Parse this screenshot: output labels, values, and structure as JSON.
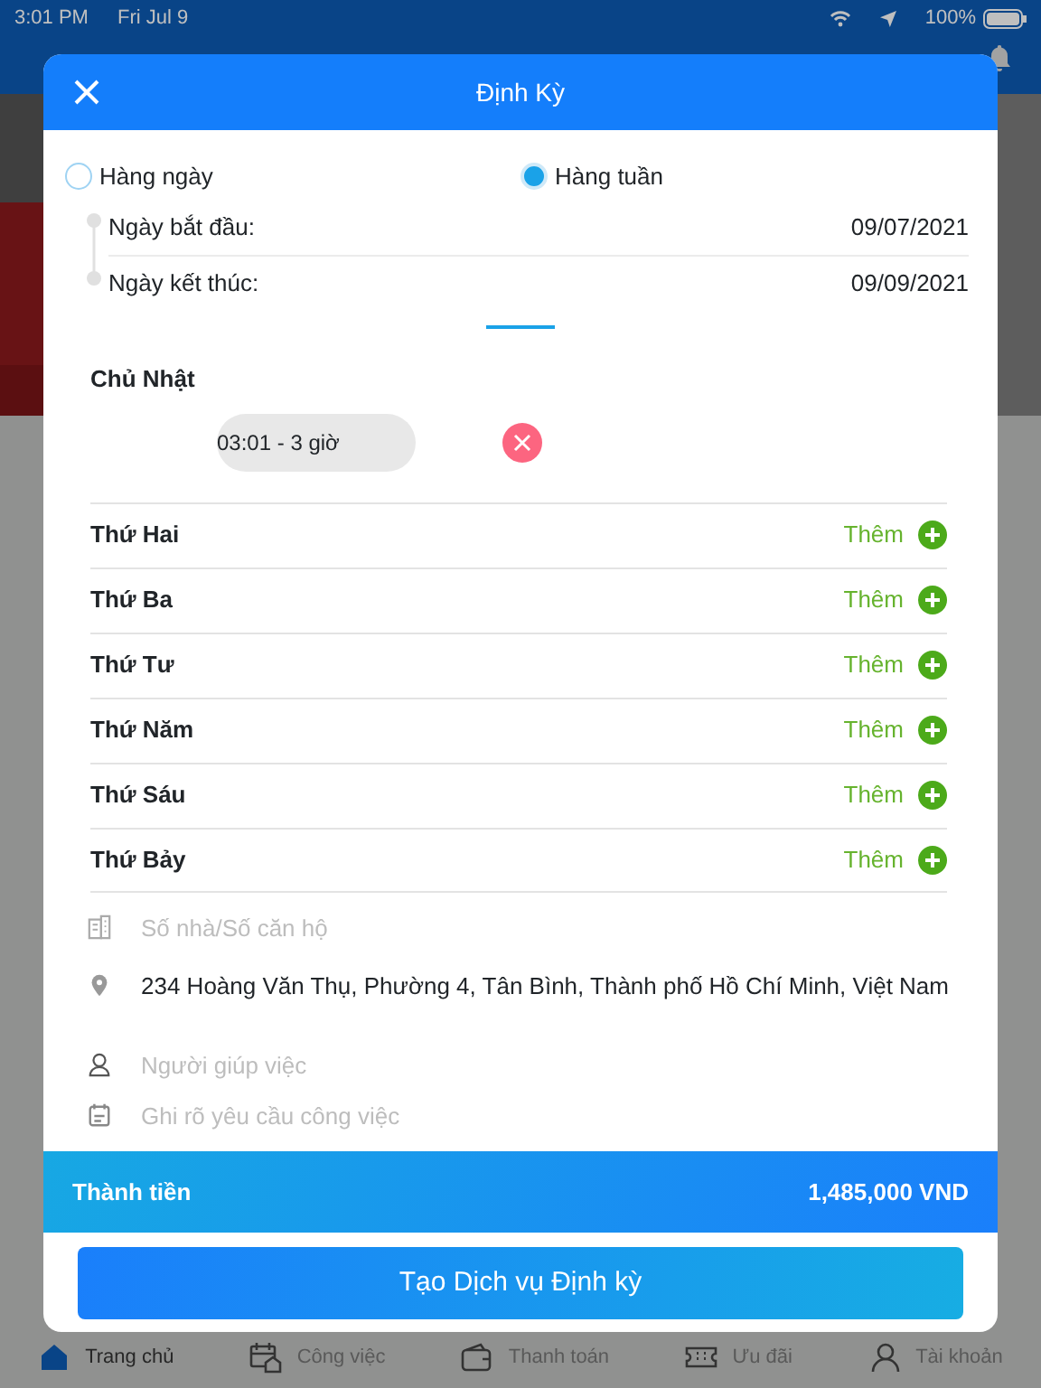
{
  "status_bar": {
    "time": "3:01 PM",
    "date": "Fri Jul 9",
    "battery": "100%"
  },
  "modal": {
    "title": "Định Kỳ",
    "frequency": [
      {
        "label": "Hàng ngày",
        "selected": false
      },
      {
        "label": "Hàng tuần",
        "selected": true
      }
    ],
    "dates": [
      {
        "label": "Ngày bắt đầu:",
        "value": "09/07/2021"
      },
      {
        "label": "Ngày kết thúc:",
        "value": "09/09/2021"
      }
    ],
    "days": [
      {
        "name": "Chủ Nhật",
        "kind": "scheduled",
        "slots": [
          {
            "label": "03:01 - 3 giờ"
          }
        ]
      },
      {
        "name": "Thứ Hai",
        "kind": "empty",
        "add_label": "Thêm"
      },
      {
        "name": "Thứ Ba",
        "kind": "empty",
        "add_label": "Thêm"
      },
      {
        "name": "Thứ Tư",
        "kind": "empty",
        "add_label": "Thêm"
      },
      {
        "name": "Thứ Năm",
        "kind": "empty",
        "add_label": "Thêm"
      },
      {
        "name": "Thứ Sáu",
        "kind": "empty",
        "add_label": "Thêm"
      },
      {
        "name": "Thứ Bảy",
        "kind": "empty",
        "add_label": "Thêm"
      }
    ],
    "fields": [
      {
        "kind": "building",
        "placeholder": "Số nhà/Số căn hộ"
      },
      {
        "kind": "location",
        "value": "234 Hoàng Văn Thụ, Phường 4, Tân Bình, Thành phố Hồ Chí Minh, Việt Nam"
      },
      {
        "kind": "helper",
        "placeholder": "Người giúp việc"
      },
      {
        "kind": "note",
        "placeholder": "Ghi rõ yêu cầu công việc"
      }
    ],
    "total": {
      "label": "Thành tiền",
      "value": "1,485,000 VND"
    },
    "submit": "Tạo Dịch vụ Định kỳ"
  },
  "tab_bar": [
    {
      "label": "Trang chủ",
      "kind": "home",
      "selected": true
    },
    {
      "label": "Công việc",
      "kind": "jobs",
      "selected": false
    },
    {
      "label": "Thanh toán",
      "kind": "wallet",
      "selected": false
    },
    {
      "label": "Ưu đãi",
      "kind": "ticket",
      "selected": false
    },
    {
      "label": "Tài khoản",
      "kind": "account",
      "selected": false
    }
  ]
}
